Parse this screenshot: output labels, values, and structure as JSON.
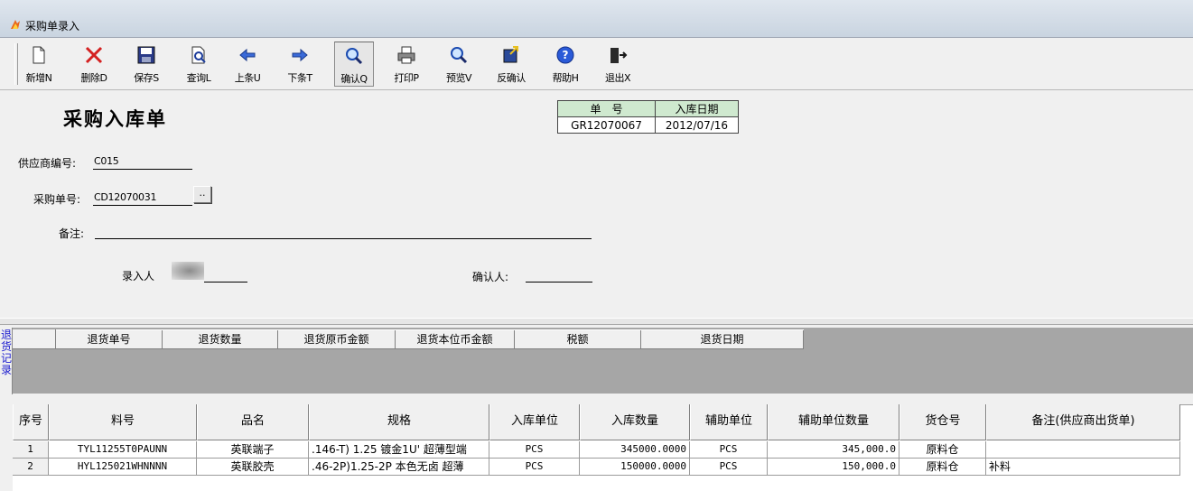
{
  "window": {
    "title": "采购单录入"
  },
  "toolbar": {
    "buttons": [
      {
        "name": "new",
        "label": "新增N",
        "icon": "new-document-icon"
      },
      {
        "name": "delete",
        "label": "删除D",
        "icon": "delete-x-icon"
      },
      {
        "name": "save",
        "label": "保存S",
        "icon": "save-disk-icon"
      },
      {
        "name": "query",
        "label": "查询L",
        "icon": "query-document-icon"
      },
      {
        "name": "prev",
        "label": "上条U",
        "icon": "arrow-left-icon"
      },
      {
        "name": "next",
        "label": "下条T",
        "icon": "arrow-right-icon"
      },
      {
        "name": "confirm",
        "label": "确认Q",
        "icon": "magnifier-icon"
      },
      {
        "name": "print",
        "label": "打印P",
        "icon": "printer-icon"
      },
      {
        "name": "preview",
        "label": "预览V",
        "icon": "preview-magnifier-icon"
      },
      {
        "name": "unconfirm",
        "label": "反确认",
        "icon": "unconfirm-icon"
      },
      {
        "name": "help",
        "label": "帮助H",
        "icon": "help-question-icon"
      },
      {
        "name": "exit",
        "label": "退出X",
        "icon": "exit-door-icon"
      }
    ]
  },
  "form": {
    "doc_title": "采购入库单",
    "info": {
      "headers": [
        "单　号",
        "入库日期"
      ],
      "values": [
        "GR12070067",
        "2012/07/16"
      ]
    },
    "supplier_label": "供应商编号:",
    "supplier_value": "C015",
    "po_label": "采购单号:",
    "po_value": "CD12070031",
    "lookup_label": "..",
    "remark_label": "备注:",
    "remark_value": "",
    "entered_by_label": "录入人",
    "confirmed_by_label": "确认人:",
    "confirmed_by_value": ""
  },
  "returns": {
    "side_label": "退货记录",
    "columns": [
      "退货单号",
      "退货数量",
      "退货原币金额",
      "退货本位币金额",
      "税额",
      "退货日期"
    ]
  },
  "grid": {
    "columns": [
      "序号",
      "料号",
      "品名",
      "规格",
      "入库单位",
      "入库数量",
      "辅助单位",
      "辅助单位数量",
      "货仓号",
      "备注(供应商出货单)"
    ],
    "rows": [
      {
        "seq": "1",
        "part": "TYL11255T0PAUNN",
        "name": "英联端子",
        "spec": ".146-T) 1.25 镀金1U' 超薄型端",
        "unit": "PCS",
        "qty": "345000.0000",
        "aux_unit": "PCS",
        "aux_qty": "345,000.0",
        "warehouse": "原料仓",
        "remark": ""
      },
      {
        "seq": "2",
        "part": "HYL125021WHNNNN",
        "name": "英联胶壳",
        "spec": ".46-2P)1.25-2P 本色无卤  超薄",
        "unit": "PCS",
        "qty": "150000.0000",
        "aux_unit": "PCS",
        "aux_qty": "150,000.0",
        "warehouse": "原料仓",
        "remark": "补料"
      }
    ]
  }
}
